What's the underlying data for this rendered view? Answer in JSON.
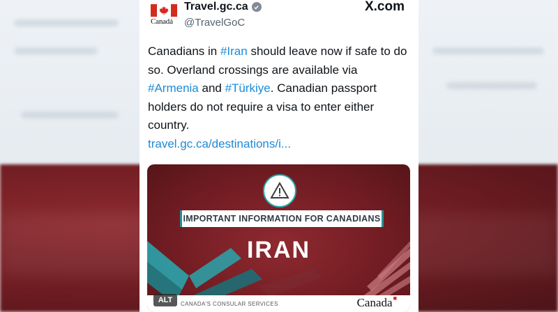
{
  "account": {
    "display_name": "Travel.gc.ca",
    "handle": "@TravelGoC",
    "logo_wordmark": "Canadá"
  },
  "site": {
    "brand": "X.com"
  },
  "tweet": {
    "parts": [
      {
        "text": "Canadians in ",
        "kind": "text"
      },
      {
        "text": "#Iran",
        "kind": "hashtag"
      },
      {
        "text": " should leave now if safe to do so. Overland crossings are available via ",
        "kind": "text"
      },
      {
        "text": "#Armenia",
        "kind": "hashtag"
      },
      {
        "text": " and ",
        "kind": "text"
      },
      {
        "text": "#Türkiye",
        "kind": "hashtag"
      },
      {
        "text": ". Canadian passport holders do not require a visa to enter either country.",
        "kind": "text"
      }
    ],
    "link": "travel.gc.ca/destinations/i..."
  },
  "media": {
    "banner_text": "IMPORTANT INFORMATION FOR CANADIANS",
    "country": "IRAN",
    "footer_left": "CANADA'S CONSULAR SERVICES",
    "footer_right": "Canada",
    "alt_label": "ALT"
  },
  "colors": {
    "hashtag": "#1d8ad6",
    "flag_red": "#d52b1e",
    "media_bg": "#701c22",
    "teal": "#2b8f95"
  },
  "icons": [
    "canada-flag-icon",
    "verified-badge-icon",
    "warning-icon"
  ]
}
